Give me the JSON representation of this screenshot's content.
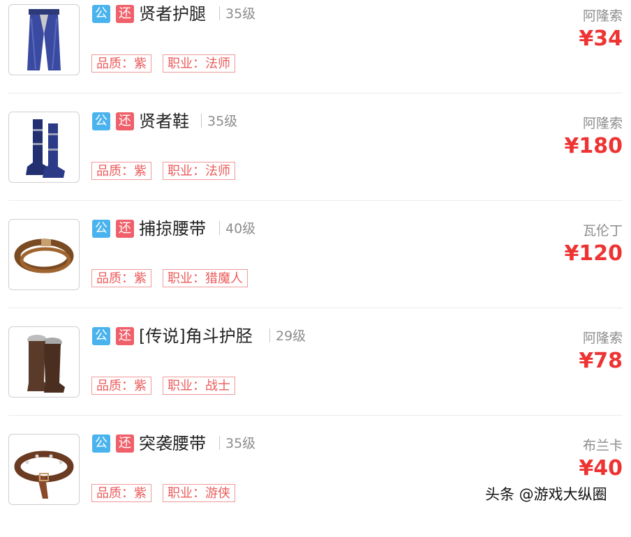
{
  "items": [
    {
      "badges": [
        "公",
        "还"
      ],
      "name": "贤者护腿",
      "level": "35级",
      "quality": "品质：紫",
      "job": "职业：法师",
      "server": "阿隆索",
      "price": "¥34",
      "icon": "leggings-icon"
    },
    {
      "badges": [
        "公",
        "还"
      ],
      "name": "贤者鞋",
      "level": "35级",
      "quality": "品质：紫",
      "job": "职业：法师",
      "server": "阿隆索",
      "price": "¥180",
      "icon": "boots-icon"
    },
    {
      "badges": [
        "公",
        "还"
      ],
      "name": "捕掠腰带",
      "level": "40级",
      "quality": "品质：紫",
      "job": "职业：猎魔人",
      "server": "瓦伦丁",
      "price": "¥120",
      "icon": "belt-icon"
    },
    {
      "badges": [
        "公",
        "还"
      ],
      "name": "[传说]角斗护胫",
      "level": "29级",
      "quality": "品质：紫",
      "job": "职业：战士",
      "server": "阿隆索",
      "price": "¥78",
      "icon": "fur-boots-icon"
    },
    {
      "badges": [
        "公",
        "还"
      ],
      "name": "突袭腰带",
      "level": "35级",
      "quality": "品质：紫",
      "job": "职业：游侠",
      "server": "布兰卡",
      "price": "¥40",
      "icon": "studded-belt-icon"
    }
  ],
  "colors": {
    "badge_pub": "#4ab3ee",
    "badge_ret": "#f0606a",
    "price": "#ee3333",
    "tag": "#ec5a5a"
  },
  "watermark": "头条 @游戏大纵圈"
}
